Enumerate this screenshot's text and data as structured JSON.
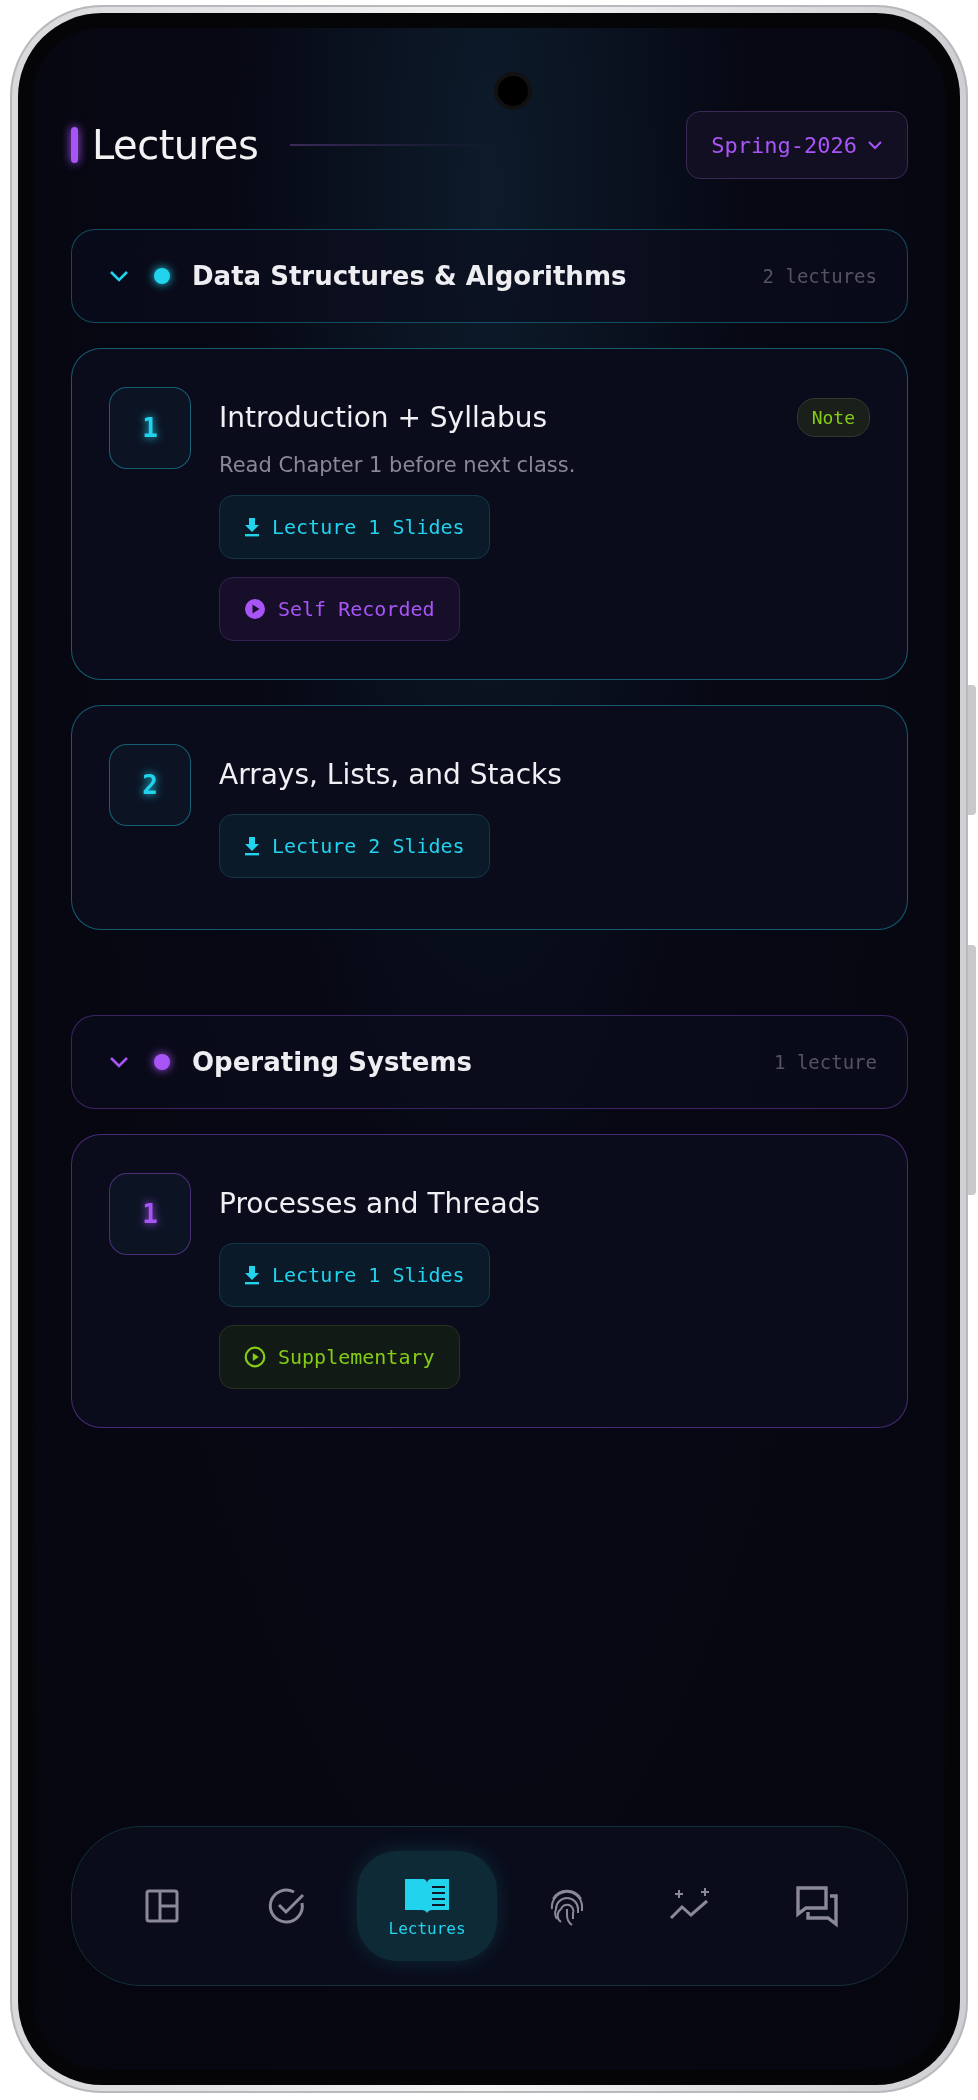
{
  "header": {
    "title": "Lectures"
  },
  "semester": {
    "value": "Spring-2026"
  },
  "courses": [
    {
      "name": "Data Structures & Algorithms",
      "count": "2 lectures",
      "expanded": true,
      "color": "#22d3ee",
      "lectures": [
        {
          "number": "1",
          "title": "Introduction + Syllabus",
          "badge": "Note",
          "note": "Read Chapter 1 before next class.",
          "resources": [
            {
              "kind": "slides",
              "label": "Lecture 1 Slides"
            },
            {
              "kind": "self_recorded",
              "label": "Self Recorded"
            }
          ]
        },
        {
          "number": "2",
          "title": "Arrays, Lists, and Stacks",
          "resources": [
            {
              "kind": "slides",
              "label": "Lecture 2 Slides"
            }
          ]
        }
      ]
    },
    {
      "name": "Operating Systems",
      "count": "1 lecture",
      "expanded": true,
      "color": "#a855f7",
      "lectures": [
        {
          "number": "1",
          "title": "Processes and Threads",
          "resources": [
            {
              "kind": "slides",
              "label": "Lecture 1 Slides"
            },
            {
              "kind": "supplementary",
              "label": "Supplementary"
            }
          ]
        }
      ]
    }
  ],
  "nav": [
    {
      "kind": "layout",
      "selected": false
    },
    {
      "kind": "check",
      "selected": false
    },
    {
      "kind": "lectures",
      "label": "Lectures",
      "selected": true
    },
    {
      "kind": "fingerprint",
      "selected": false
    },
    {
      "kind": "trend",
      "selected": false
    },
    {
      "kind": "chat",
      "selected": false
    }
  ]
}
